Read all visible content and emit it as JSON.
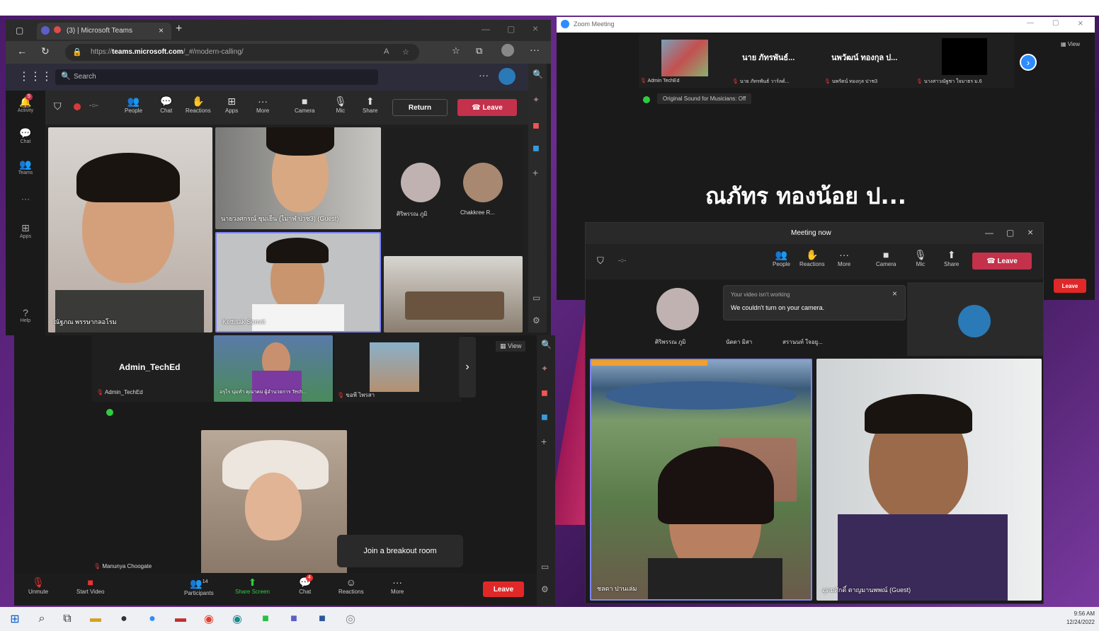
{
  "teams": {
    "tab_title": "(3) | Microsoft Teams",
    "url_prefix": "https://",
    "url_host": "teams.microsoft.com",
    "url_path": "/_#/modern-calling/",
    "search_placeholder": "Search",
    "rail": [
      {
        "label": "Activity",
        "icon": "bell-icon",
        "badge": "5"
      },
      {
        "label": "Chat",
        "icon": "chat-icon"
      },
      {
        "label": "Teams",
        "icon": "teams-icon"
      },
      {
        "label": "Apps",
        "icon": "apps-icon"
      },
      {
        "label": "Help",
        "icon": "help-icon"
      }
    ],
    "toolbar": {
      "people": "People",
      "chat": "Chat",
      "reactions": "Reactions",
      "apps": "Apps",
      "more": "More",
      "camera": "Camera",
      "mic": "Mic",
      "share": "Share",
      "return": "Return",
      "leave": "Leave"
    },
    "participants": {
      "p1": "ณัฐภณ พรรษากลอโรม",
      "p2": "นายวงศกรณ์ ชุมเย็น (ไมาฬ ปาช3) (Guest)",
      "p3": "Kettisak Somrit",
      "p4": "ศิริพรรณ ภูมิ",
      "p5": "Chakkree R..."
    }
  },
  "zoom_left": {
    "admin_name": "Admin_TechEd",
    "admin_label": "Admin_TechEd",
    "p_woman": "อรุไร นุ่มทำ คุณาคม ผู้อำนวยการ Tech...",
    "p_room": "ขอพี ไพรสา",
    "p_main": "Manunya Choogate",
    "view": "View",
    "breakout": "Join a breakout room",
    "toolbar": {
      "unmute": "Unmute",
      "start_video": "Start Video",
      "participants": "Participants",
      "participants_count": "14",
      "share": "Share Screen",
      "chat": "Chat",
      "chat_badge": "4",
      "reactions": "Reactions",
      "more": "More",
      "leave": "Leave"
    }
  },
  "zoom_right": {
    "title": "Zoom Meeting",
    "view": "View",
    "strip": [
      {
        "name": "Admin TechEd"
      },
      {
        "big": "นาย ภัทรพันธ์...",
        "name": "นาย ภัทรพันธ์ วาร์ลด์..."
      },
      {
        "big": "นพวัฒน์ ทองกุล ป...",
        "name": "นพรัตน์ ทองกุล ปาช3"
      },
      {
        "name": "นางสาวณัฐชา ใจมาธร ม.6"
      }
    ],
    "sound": "Original Sound for Musicians: Off",
    "speaker": "ณภัทร ทองน้อย ป...",
    "leave": "Leave"
  },
  "meeting_now": {
    "title": "Meeting now",
    "toolbar": {
      "people": "People",
      "reactions": "Reactions",
      "more": "More",
      "camera": "Camera",
      "mic": "Mic",
      "share": "Share",
      "leave": "Leave"
    },
    "toast_title": "Your video isn't working",
    "toast_body": "We couldn't turn on your camera.",
    "p1": "ศิริพรรณ ภูมิ",
    "p2": "นัดดา มิสา",
    "p3": "สรานนท์ ใจอยู...",
    "p_campus": "ชลดา ปานเล่ม",
    "p_boy": "อุดมศักดิ์ ตาญมานพพณ์ (Guest)"
  },
  "taskbar": {
    "time": "9:56 AM",
    "date": "12/24/2022"
  }
}
